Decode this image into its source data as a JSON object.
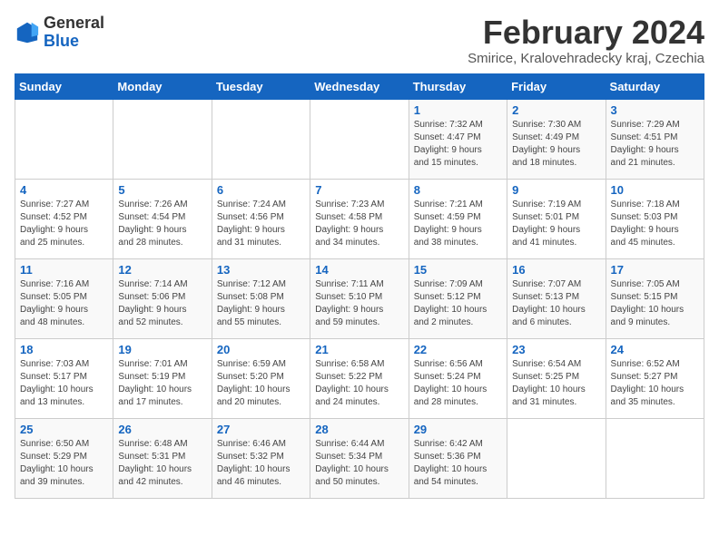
{
  "logo": {
    "general": "General",
    "blue": "Blue"
  },
  "title": "February 2024",
  "location": "Smirice, Kralovehradecky kraj, Czechia",
  "days_of_week": [
    "Sunday",
    "Monday",
    "Tuesday",
    "Wednesday",
    "Thursday",
    "Friday",
    "Saturday"
  ],
  "weeks": [
    [
      {
        "day": "",
        "info": ""
      },
      {
        "day": "",
        "info": ""
      },
      {
        "day": "",
        "info": ""
      },
      {
        "day": "",
        "info": ""
      },
      {
        "day": "1",
        "info": "Sunrise: 7:32 AM\nSunset: 4:47 PM\nDaylight: 9 hours\nand 15 minutes."
      },
      {
        "day": "2",
        "info": "Sunrise: 7:30 AM\nSunset: 4:49 PM\nDaylight: 9 hours\nand 18 minutes."
      },
      {
        "day": "3",
        "info": "Sunrise: 7:29 AM\nSunset: 4:51 PM\nDaylight: 9 hours\nand 21 minutes."
      }
    ],
    [
      {
        "day": "4",
        "info": "Sunrise: 7:27 AM\nSunset: 4:52 PM\nDaylight: 9 hours\nand 25 minutes."
      },
      {
        "day": "5",
        "info": "Sunrise: 7:26 AM\nSunset: 4:54 PM\nDaylight: 9 hours\nand 28 minutes."
      },
      {
        "day": "6",
        "info": "Sunrise: 7:24 AM\nSunset: 4:56 PM\nDaylight: 9 hours\nand 31 minutes."
      },
      {
        "day": "7",
        "info": "Sunrise: 7:23 AM\nSunset: 4:58 PM\nDaylight: 9 hours\nand 34 minutes."
      },
      {
        "day": "8",
        "info": "Sunrise: 7:21 AM\nSunset: 4:59 PM\nDaylight: 9 hours\nand 38 minutes."
      },
      {
        "day": "9",
        "info": "Sunrise: 7:19 AM\nSunset: 5:01 PM\nDaylight: 9 hours\nand 41 minutes."
      },
      {
        "day": "10",
        "info": "Sunrise: 7:18 AM\nSunset: 5:03 PM\nDaylight: 9 hours\nand 45 minutes."
      }
    ],
    [
      {
        "day": "11",
        "info": "Sunrise: 7:16 AM\nSunset: 5:05 PM\nDaylight: 9 hours\nand 48 minutes."
      },
      {
        "day": "12",
        "info": "Sunrise: 7:14 AM\nSunset: 5:06 PM\nDaylight: 9 hours\nand 52 minutes."
      },
      {
        "day": "13",
        "info": "Sunrise: 7:12 AM\nSunset: 5:08 PM\nDaylight: 9 hours\nand 55 minutes."
      },
      {
        "day": "14",
        "info": "Sunrise: 7:11 AM\nSunset: 5:10 PM\nDaylight: 9 hours\nand 59 minutes."
      },
      {
        "day": "15",
        "info": "Sunrise: 7:09 AM\nSunset: 5:12 PM\nDaylight: 10 hours\nand 2 minutes."
      },
      {
        "day": "16",
        "info": "Sunrise: 7:07 AM\nSunset: 5:13 PM\nDaylight: 10 hours\nand 6 minutes."
      },
      {
        "day": "17",
        "info": "Sunrise: 7:05 AM\nSunset: 5:15 PM\nDaylight: 10 hours\nand 9 minutes."
      }
    ],
    [
      {
        "day": "18",
        "info": "Sunrise: 7:03 AM\nSunset: 5:17 PM\nDaylight: 10 hours\nand 13 minutes."
      },
      {
        "day": "19",
        "info": "Sunrise: 7:01 AM\nSunset: 5:19 PM\nDaylight: 10 hours\nand 17 minutes."
      },
      {
        "day": "20",
        "info": "Sunrise: 6:59 AM\nSunset: 5:20 PM\nDaylight: 10 hours\nand 20 minutes."
      },
      {
        "day": "21",
        "info": "Sunrise: 6:58 AM\nSunset: 5:22 PM\nDaylight: 10 hours\nand 24 minutes."
      },
      {
        "day": "22",
        "info": "Sunrise: 6:56 AM\nSunset: 5:24 PM\nDaylight: 10 hours\nand 28 minutes."
      },
      {
        "day": "23",
        "info": "Sunrise: 6:54 AM\nSunset: 5:25 PM\nDaylight: 10 hours\nand 31 minutes."
      },
      {
        "day": "24",
        "info": "Sunrise: 6:52 AM\nSunset: 5:27 PM\nDaylight: 10 hours\nand 35 minutes."
      }
    ],
    [
      {
        "day": "25",
        "info": "Sunrise: 6:50 AM\nSunset: 5:29 PM\nDaylight: 10 hours\nand 39 minutes."
      },
      {
        "day": "26",
        "info": "Sunrise: 6:48 AM\nSunset: 5:31 PM\nDaylight: 10 hours\nand 42 minutes."
      },
      {
        "day": "27",
        "info": "Sunrise: 6:46 AM\nSunset: 5:32 PM\nDaylight: 10 hours\nand 46 minutes."
      },
      {
        "day": "28",
        "info": "Sunrise: 6:44 AM\nSunset: 5:34 PM\nDaylight: 10 hours\nand 50 minutes."
      },
      {
        "day": "29",
        "info": "Sunrise: 6:42 AM\nSunset: 5:36 PM\nDaylight: 10 hours\nand 54 minutes."
      },
      {
        "day": "",
        "info": ""
      },
      {
        "day": "",
        "info": ""
      }
    ]
  ]
}
